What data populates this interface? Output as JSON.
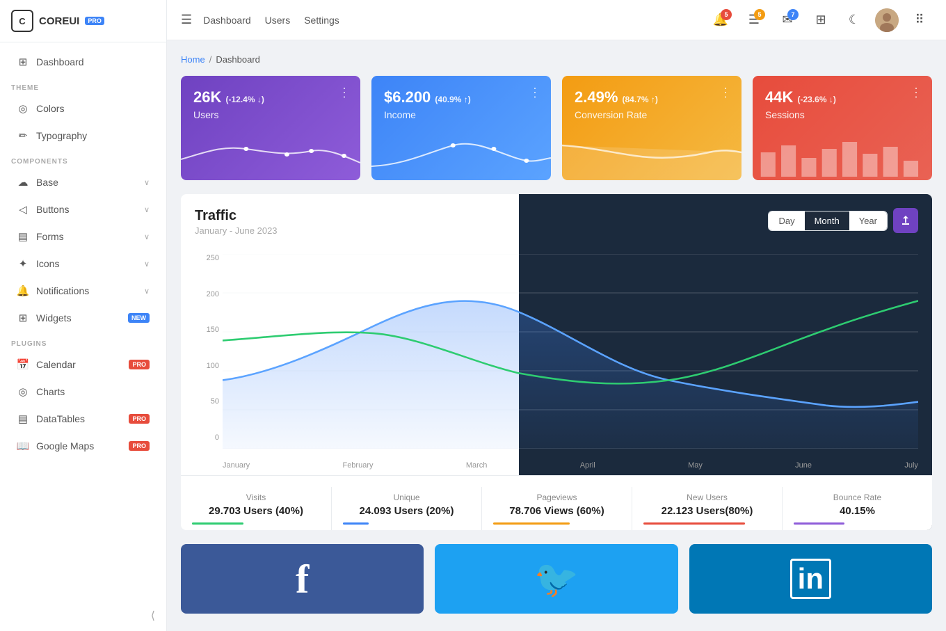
{
  "app": {
    "name": "COREUI",
    "badge": "PRO"
  },
  "sidebar": {
    "dashboard_label": "Dashboard",
    "theme_label": "THEME",
    "colors_label": "Colors",
    "typography_label": "Typography",
    "components_label": "COMPONENTS",
    "base_label": "Base",
    "buttons_label": "Buttons",
    "forms_label": "Forms",
    "icons_label": "Icons",
    "notifications_label": "Notifications",
    "widgets_label": "Widgets",
    "plugins_label": "PLUGINS",
    "calendar_label": "Calendar",
    "charts_label": "Charts",
    "datatables_label": "DataTables",
    "googlemaps_label": "Google Maps"
  },
  "header": {
    "nav_items": [
      "Dashboard",
      "Users",
      "Settings"
    ],
    "notification_count": "5",
    "tasks_count": "5",
    "messages_count": "7"
  },
  "breadcrumb": {
    "home": "Home",
    "current": "Dashboard"
  },
  "stats": [
    {
      "value": "26K",
      "change": "(-12.4% ↓)",
      "label": "Users",
      "color": "purple"
    },
    {
      "value": "$6.200",
      "change": "(40.9% ↑)",
      "label": "Income",
      "color": "blue"
    },
    {
      "value": "2.49%",
      "change": "(84.7% ↑)",
      "label": "Conversion Rate",
      "color": "yellow"
    },
    {
      "value": "44K",
      "change": "(-23.6% ↓)",
      "label": "Sessions",
      "color": "red"
    }
  ],
  "traffic": {
    "title": "Traffic",
    "subtitle": "January - June 2023",
    "view_day": "Day",
    "view_month": "Month",
    "view_year": "Year",
    "active_view": "Month",
    "y_labels": [
      "250",
      "200",
      "150",
      "100",
      "50",
      "0"
    ],
    "x_labels": [
      "January",
      "February",
      "March",
      "April",
      "May",
      "June",
      "July"
    ]
  },
  "chart_stats": [
    {
      "label": "Visits",
      "value": "29.703 Users (40%)",
      "bar_color": "#2ecc71",
      "width": "40%"
    },
    {
      "label": "Unique",
      "value": "24.093 Users (20%)",
      "bar_color": "#3d84f7",
      "width": "20%"
    },
    {
      "label": "Pageviews",
      "value": "78.706 Views (60%)",
      "bar_color": "#f39c12",
      "width": "60%"
    },
    {
      "label": "New Users",
      "value": "22.123 Users(80%)",
      "bar_color": "#e74c3c",
      "width": "80%"
    },
    {
      "label": "Bounce Rate",
      "value": "40.15%",
      "bar_color": "#8e5cd9",
      "width": "40%"
    }
  ],
  "social": [
    {
      "name": "Facebook",
      "icon": "f",
      "color": "#3b5998"
    },
    {
      "name": "Twitter",
      "icon": "🐦",
      "color": "#1da1f2"
    },
    {
      "name": "LinkedIn",
      "icon": "in",
      "color": "#0077b5"
    }
  ]
}
